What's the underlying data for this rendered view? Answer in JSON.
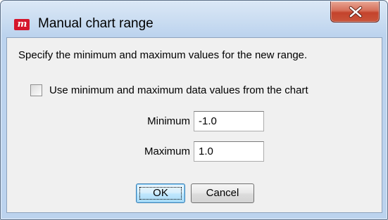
{
  "window": {
    "title": "Manual chart range",
    "app_icon_text": "m",
    "app_icon_name": "app-logo-icon",
    "close_icon_name": "close-icon",
    "accent_color": "#d5152b"
  },
  "dialog": {
    "instruction": "Specify the minimum and maximum values for the new range.",
    "use_data_values": {
      "label": "Use minimum and maximum data values from the chart",
      "checked": false
    },
    "minimum": {
      "label": "Minimum",
      "value": "-1.0"
    },
    "maximum": {
      "label": "Maximum",
      "value": "1.0"
    },
    "buttons": {
      "ok": "OK",
      "cancel": "Cancel"
    }
  }
}
